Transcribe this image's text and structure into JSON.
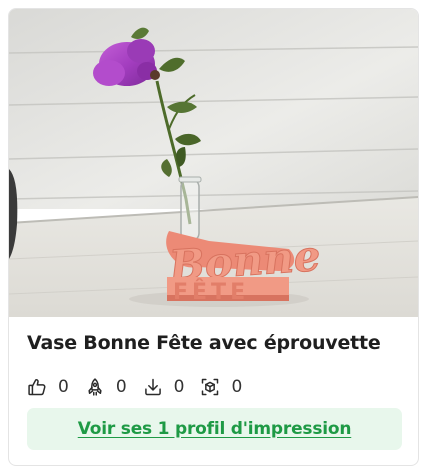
{
  "card": {
    "title": "Vase Bonne Fête avec éprouvette",
    "image": {
      "alt": "Vase Bonne Fête avec éprouvette",
      "print_text_line1": "Bonne",
      "print_text_line2": "FÊTE"
    },
    "stats": [
      {
        "icon": "thumbs-up-icon",
        "value": "0"
      },
      {
        "icon": "rocket-icon",
        "value": "0"
      },
      {
        "icon": "download-icon",
        "value": "0"
      },
      {
        "icon": "3d-cube-icon",
        "value": "0"
      }
    ],
    "profile_button_label": "Voir ses 1 profil d'impression"
  },
  "colors": {
    "accent_green": "#1e9a45",
    "button_bg": "#e8f7ec",
    "print_color": "#f19a85",
    "flower_color": "#a43ec0"
  }
}
